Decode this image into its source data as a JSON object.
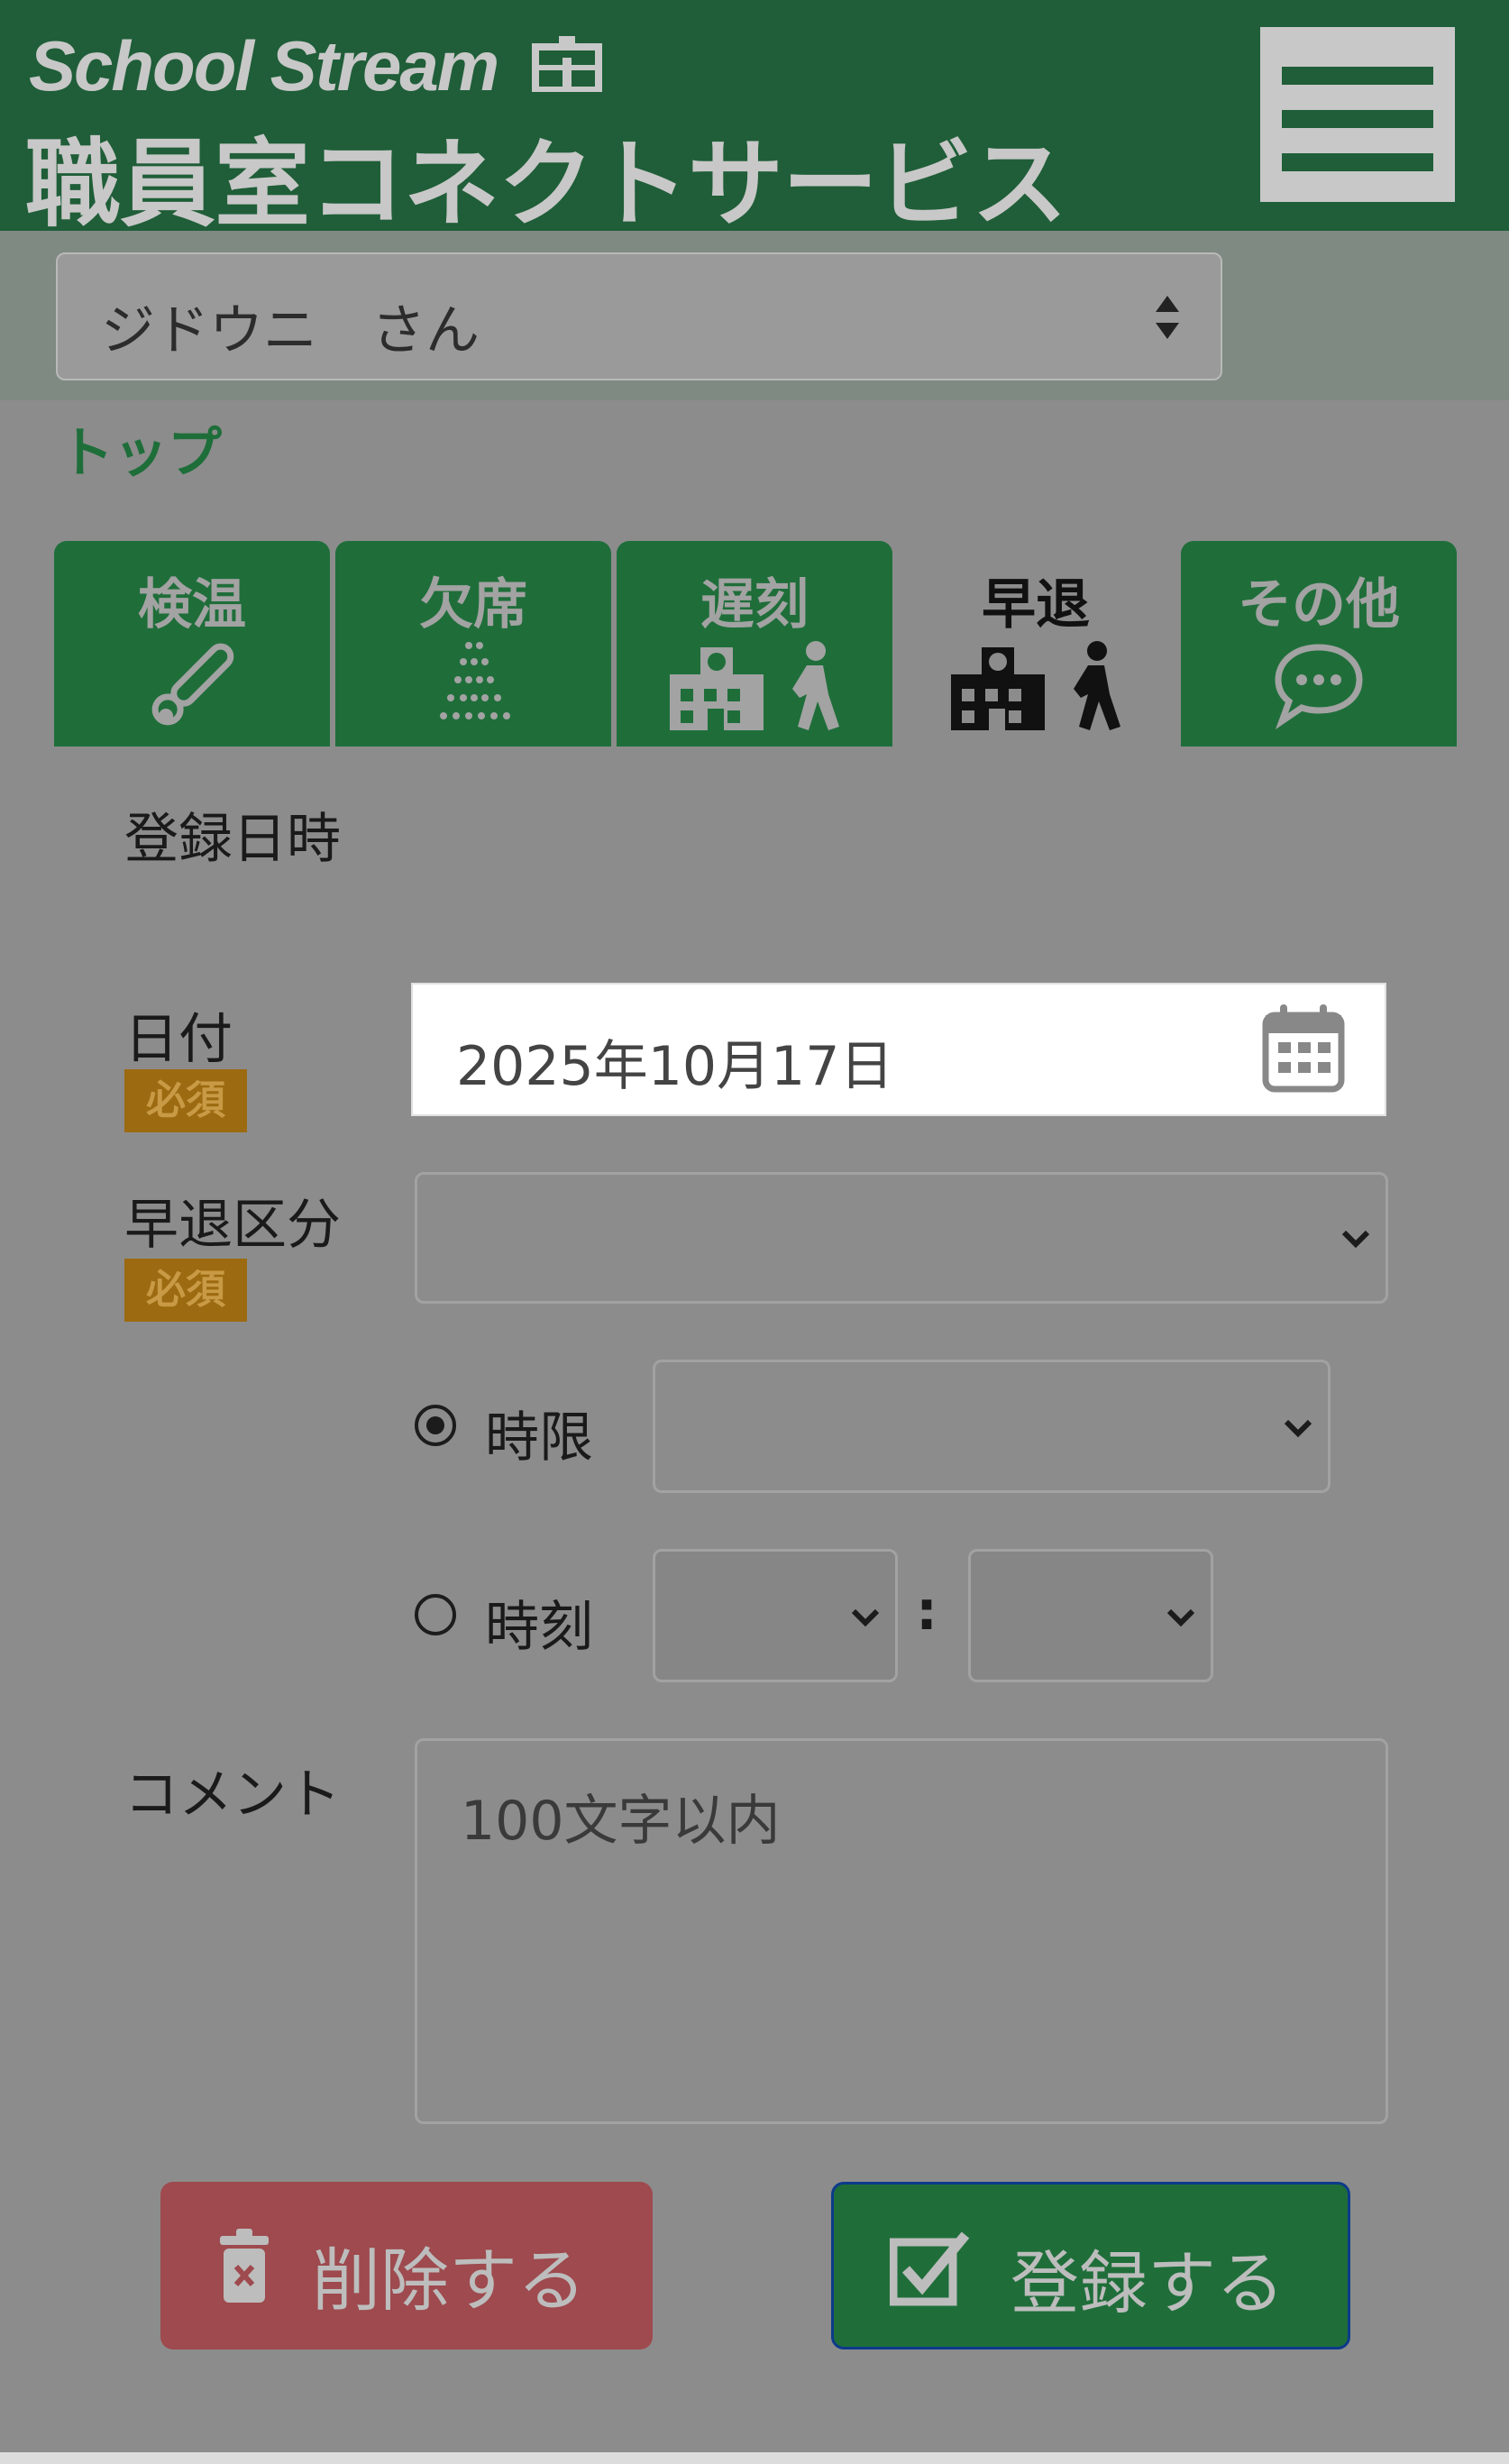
{
  "header": {
    "brand_en": "School Stream",
    "brand_jp": "職員室コネクトサービス",
    "menu_icon": "hamburger-icon"
  },
  "child_select": {
    "value": "ジドウニ　さん"
  },
  "breadcrumb": {
    "label": "トップ"
  },
  "tabs": [
    {
      "label": "検温",
      "icon": "thermometer-icon",
      "active": false
    },
    {
      "label": "欠席",
      "icon": "absence-icon",
      "active": false
    },
    {
      "label": "遅刻",
      "icon": "late-arrival-icon",
      "active": false
    },
    {
      "label": "早退",
      "icon": "early-leave-icon",
      "active": true
    },
    {
      "label": "その他",
      "icon": "speech-bubble-icon",
      "active": false
    }
  ],
  "form": {
    "section_title": "登録日時",
    "date_label": "日付",
    "required_badge": "必須",
    "date_value": "2025年10月17日",
    "category_label": "早退区分",
    "category_value": "",
    "period_label": "時限",
    "period_selected": true,
    "time_label": "時刻",
    "time_separator": ":",
    "comment_label": "コメント",
    "comment_placeholder": "100文字以内"
  },
  "buttons": {
    "delete": "削除する",
    "register": "登録する"
  },
  "colors": {
    "brand_green": "#1f5e38",
    "tab_green": "#1f6e3a",
    "required_badge": "#9c6a10",
    "delete_red": "#9e4a4e",
    "register_border": "#0c3a8a"
  }
}
